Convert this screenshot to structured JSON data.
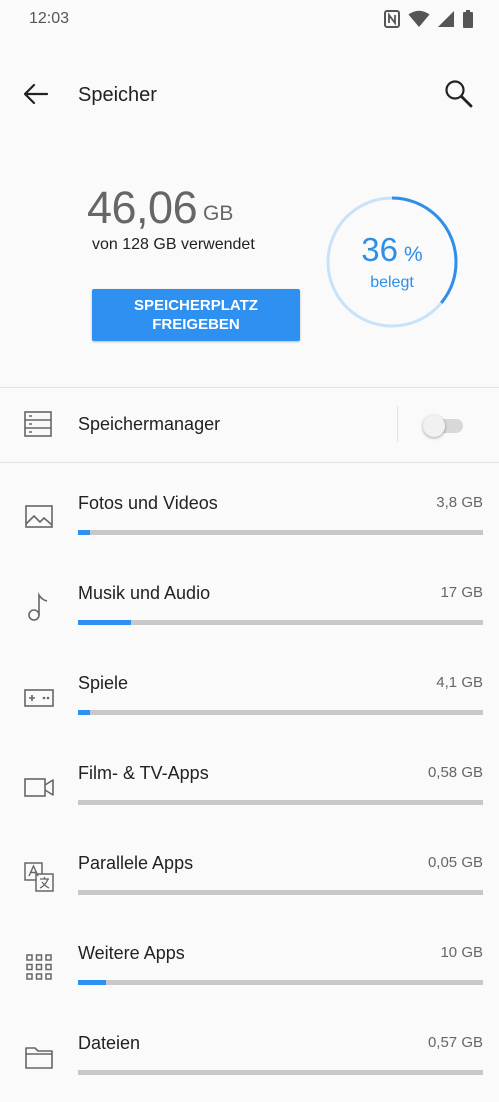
{
  "status": {
    "time": "12:03"
  },
  "appbar": {
    "title": "Speicher"
  },
  "summary": {
    "used_value": "46,06",
    "used_unit": "GB",
    "description": "von 128 GB verwendet",
    "free_button": "SPEICHERPLATZ FREIGEBEN",
    "percent": "36",
    "percent_symbol": "%",
    "percent_fraction": 0.36,
    "percent_label": "belegt"
  },
  "manager": {
    "label": "Speichermanager",
    "enabled": false
  },
  "categories": [
    {
      "name": "Fotos und Videos",
      "size": "3,8 GB",
      "fill": 0.03,
      "icon": "image-icon"
    },
    {
      "name": "Musik und Audio",
      "size": "17 GB",
      "fill": 0.13,
      "icon": "music-note-icon"
    },
    {
      "name": "Spiele",
      "size": "4,1 GB",
      "fill": 0.03,
      "icon": "gamepad-icon"
    },
    {
      "name": "Film- & TV-Apps",
      "size": "0,58 GB",
      "fill": 0.0,
      "icon": "video-camera-icon"
    },
    {
      "name": "Parallele Apps",
      "size": "0,05 GB",
      "fill": 0.0,
      "icon": "translate-icon"
    },
    {
      "name": "Weitere Apps",
      "size": "10 GB",
      "fill": 0.07,
      "icon": "apps-grid-icon"
    },
    {
      "name": "Dateien",
      "size": "0,57 GB",
      "fill": 0.0,
      "icon": "folder-icon"
    }
  ],
  "colors": {
    "accent": "#2e90f0",
    "track": "#c8c8c8",
    "ring_track": "#c9e2f7"
  }
}
